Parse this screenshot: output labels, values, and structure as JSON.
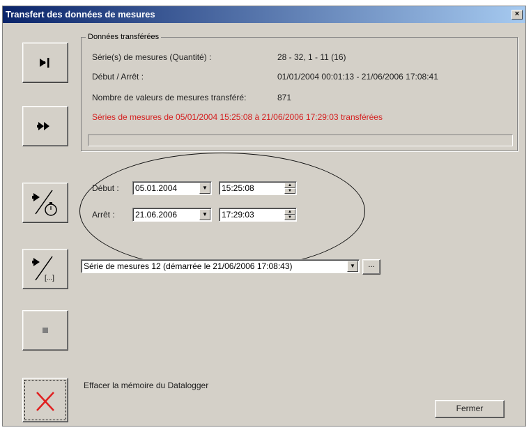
{
  "window": {
    "title": "Transfert des données de mesures",
    "close_glyph": "×"
  },
  "group": {
    "legend": "Données transférées",
    "rows": [
      {
        "label": "Série(s) de mesures (Quantité) :",
        "value": "28 - 32, 1 - 11 (16)"
      },
      {
        "label": "Début / Arrêt :",
        "value": "01/01/2004 00:01:13 - 21/06/2006 17:08:41"
      },
      {
        "label": "Nombre de valeurs de mesures transféré:",
        "value": "871"
      }
    ],
    "status": "Séries de mesures de 05/01/2004 15:25:08 à 21/06/2006 17:29:03 transférées",
    "progress_fraction": 0.0
  },
  "range": {
    "debut_label": "Début :",
    "debut_date": "05.01.2004",
    "debut_time": "15:25:08",
    "arret_label": "Arrêt :",
    "arret_date": "21.06.2006",
    "arret_time": "17:29:03"
  },
  "series": {
    "selected": "Série de mesures 12 (démarrée le 21/06/2006 17:08:43)",
    "browse_label": "..."
  },
  "erase": {
    "label": "Effacer la mémoire du Datalogger"
  },
  "footer": {
    "close_label": "Fermer"
  },
  "icons": {
    "transfer_to_end": "arrow-to-bar-icon",
    "transfer_all": "double-arrow-icon",
    "transfer_time_range": "arrow-stopwatch-icon",
    "transfer_series": "arrow-bracket-icon",
    "stop": "stop-icon",
    "erase": "red-x-icon"
  },
  "colors": {
    "titlebar_start": "#0a246a",
    "titlebar_end": "#a6caf0",
    "status_text": "#d42020",
    "erase_x": "#e02020",
    "face": "#d4d0c8"
  }
}
